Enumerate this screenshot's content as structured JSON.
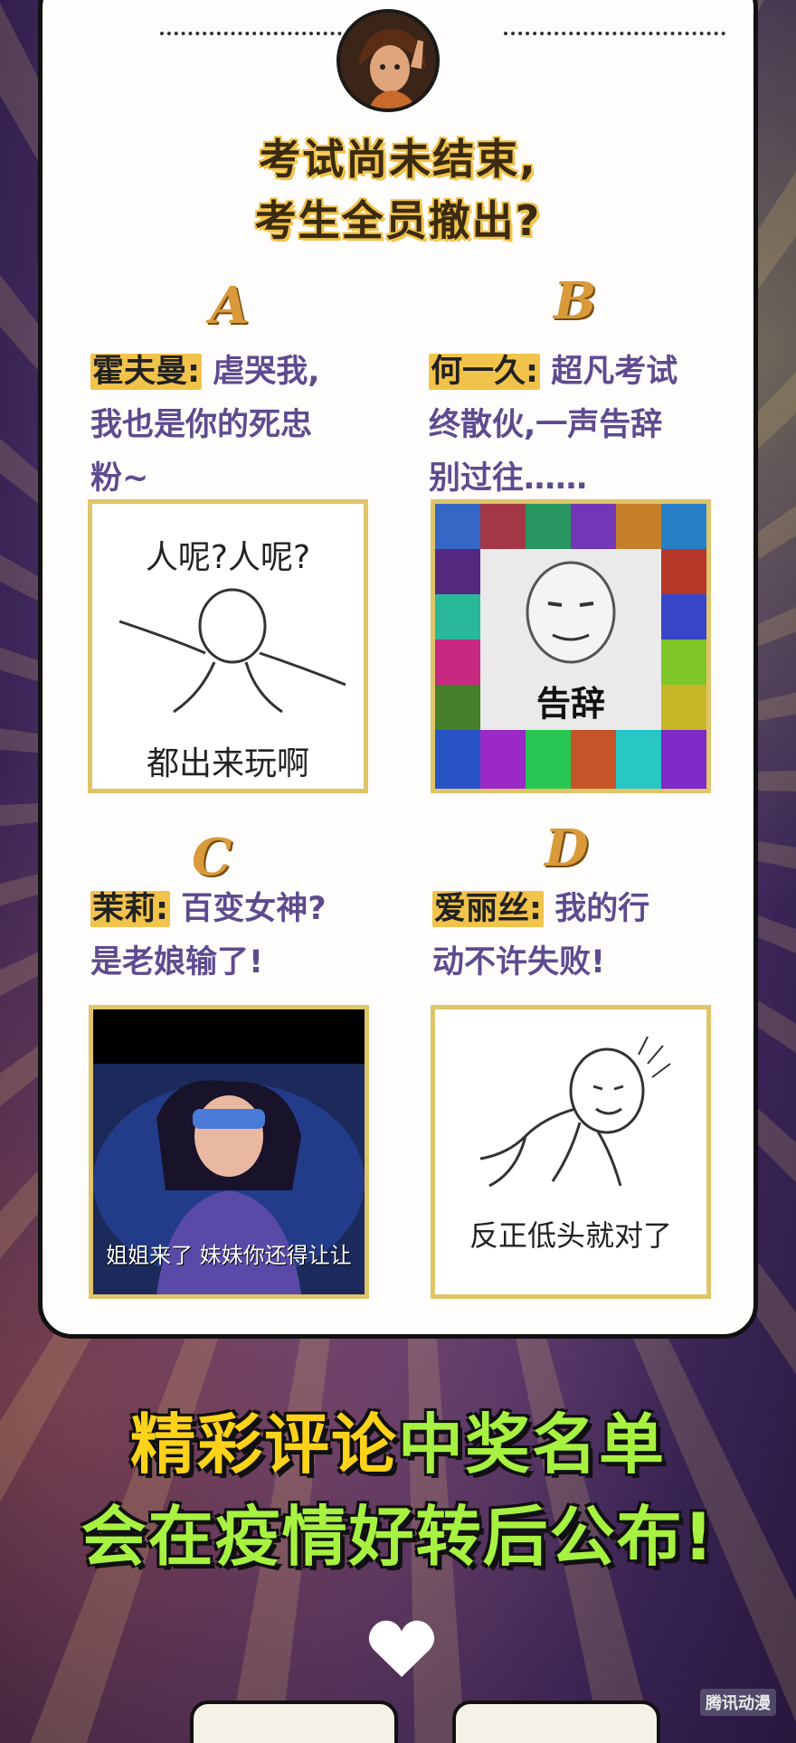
{
  "question": {
    "line1": "考试尚未结束,",
    "line2": "考生全员撤出?"
  },
  "options": [
    {
      "letter": "A",
      "name": "霍夫曼:",
      "text": "虐哭我,",
      "text2": "我也是你的死忠",
      "text3": "粉~",
      "meme_top": "人呢?人呢?",
      "meme_bottom": "都出来玩啊"
    },
    {
      "letter": "B",
      "name": "何一久:",
      "text": "超凡考试",
      "text2": "终散伙,一声告辞",
      "text3": "别过往……",
      "meme_bottom": "告辞"
    },
    {
      "letter": "C",
      "name": "茉莉:",
      "text": "百变女神?",
      "text2": "是老娘输了!",
      "meme_bottom": "姐姐来了 妹妹你还得让让"
    },
    {
      "letter": "D",
      "name": "爱丽丝:",
      "text": "我的行",
      "text2": "动不许失败!",
      "meme_bottom": "反正低头就对了"
    }
  ],
  "banner": {
    "line1_a": "精彩评论",
    "line1_b": "中奖名单",
    "line2": "会在疫情好转后公布!"
  },
  "watermark": "腾讯动漫",
  "icons": {
    "heart": "heart-icon"
  },
  "colors": {
    "accent": "#f2c34a",
    "purple_text": "#5e4b8f",
    "banner_yellow": "#ffd21a",
    "banner_green": "#a7f241"
  }
}
